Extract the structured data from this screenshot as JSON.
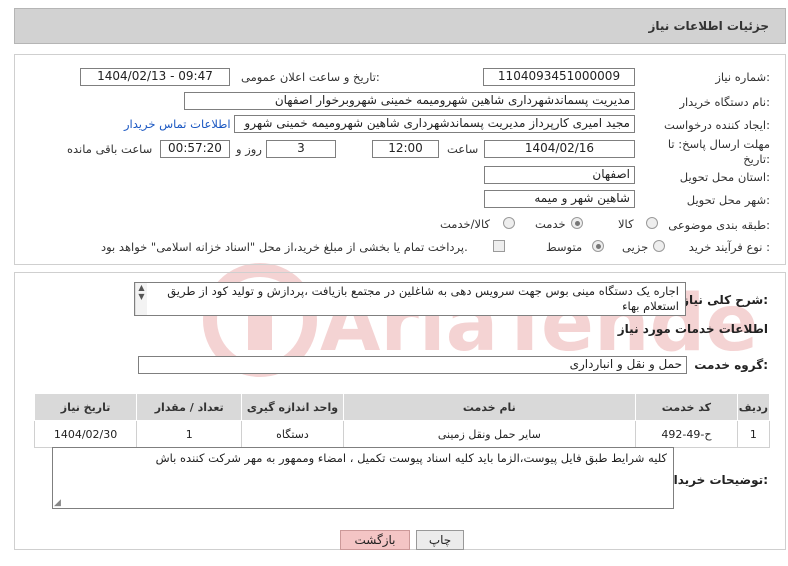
{
  "header": {
    "title": "جزئیات اطلاعات نیاز"
  },
  "fields": {
    "need_number_label": "شماره نیاز:",
    "need_number": "1104093451000009",
    "announce_label": "تاریخ و ساعت اعلان عمومی:",
    "announce_value": "1404/02/13 - 09:47",
    "buyer_label": "نام دستگاه خریدار:",
    "buyer_value": "مدیریت پسماندشهرداری شاهین شهرومیمه خمینی شهرو‌برخوار اصفهان",
    "creator_label": "ایجاد کننده درخواست:",
    "creator_value": "مجید امیری کارپرداز مدیریت پسماندشهرداری شاهین شهرومیمه خمینی شهرو",
    "contact_link": "اطلاعات تماس خریدار",
    "deadline_label": "مهلت ارسال پاسخ: تا تاریخ:",
    "deadline_date": "1404/02/16",
    "time_label": "ساعت",
    "deadline_time": "12:00",
    "days_value": "3",
    "days_label": "روز و",
    "remaining_time": "00:57:20",
    "remaining_label": "ساعت باقی مانده",
    "province_label": "استان محل تحویل:",
    "province_value": "اصفهان",
    "city_label": "شهر محل تحویل:",
    "city_value": "شاهین شهر و میمه",
    "category_label": "طبقه بندی موضوعی:",
    "category_options": [
      "کالا",
      "خدمت",
      "کالا/خدمت"
    ],
    "category_selected": "خدمت",
    "process_label": "نوع فرآیند خرید :",
    "process_options": [
      "جزیی",
      "متوسط"
    ],
    "process_selected": "متوسط",
    "payment_note": "پرداخت تمام یا بخشی از مبلغ خرید،از محل \"اسناد خزانه اسلامی\" خواهد بود."
  },
  "description": {
    "label": "شرح کلی نیاز:",
    "text": "اجاره یک دستگاه مینی بوس جهت سرویس دهی به شاغلین در مجتمع  بازیافت ،پردازش و تولید کود  از طریق استعلام بهاء"
  },
  "services": {
    "section_title": "اطلاعات خدمات مورد نیاز",
    "group_label": "گروه خدمت:",
    "group_value": "حمل و نقل و انبارداری",
    "columns": [
      "ردیف",
      "کد خدمت",
      "نام خدمت",
      "واحد اندازه گیری",
      "تعداد / مقدار",
      "تاریخ نیاز"
    ],
    "rows": [
      [
        "1",
        "ح-49-492",
        "سایر حمل ونقل زمینی",
        "دستگاه",
        "1",
        "1404/02/30"
      ]
    ]
  },
  "buyer_notes": {
    "label": "توضیحات خریدار:",
    "text": "کلیه شرایط طبق فایل پیوست،الزما باید کلیه اسناد پیوست تکمیل ، امضاء وممهور به مهر شرکت کننده باش"
  },
  "buttons": {
    "print": "چاپ",
    "back": "بازگشت"
  },
  "watermark": {
    "text": "AriaTender.neT"
  },
  "colors": {
    "header_bg": "#d2d2d2",
    "link": "#1a57c2",
    "back_button": "#f4c5c5",
    "watermark": "#e06060"
  }
}
